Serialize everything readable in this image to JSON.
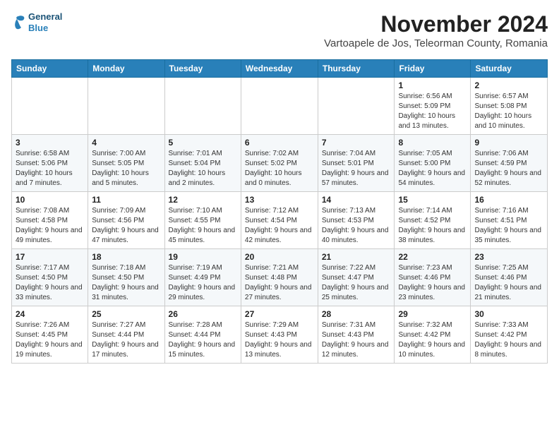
{
  "logo": {
    "line1": "General",
    "line2": "Blue"
  },
  "title": "November 2024",
  "subtitle": "Vartoapele de Jos, Teleorman County, Romania",
  "weekdays": [
    "Sunday",
    "Monday",
    "Tuesday",
    "Wednesday",
    "Thursday",
    "Friday",
    "Saturday"
  ],
  "weeks": [
    [
      {
        "day": "",
        "info": ""
      },
      {
        "day": "",
        "info": ""
      },
      {
        "day": "",
        "info": ""
      },
      {
        "day": "",
        "info": ""
      },
      {
        "day": "",
        "info": ""
      },
      {
        "day": "1",
        "info": "Sunrise: 6:56 AM\nSunset: 5:09 PM\nDaylight: 10 hours and 13 minutes."
      },
      {
        "day": "2",
        "info": "Sunrise: 6:57 AM\nSunset: 5:08 PM\nDaylight: 10 hours and 10 minutes."
      }
    ],
    [
      {
        "day": "3",
        "info": "Sunrise: 6:58 AM\nSunset: 5:06 PM\nDaylight: 10 hours and 7 minutes."
      },
      {
        "day": "4",
        "info": "Sunrise: 7:00 AM\nSunset: 5:05 PM\nDaylight: 10 hours and 5 minutes."
      },
      {
        "day": "5",
        "info": "Sunrise: 7:01 AM\nSunset: 5:04 PM\nDaylight: 10 hours and 2 minutes."
      },
      {
        "day": "6",
        "info": "Sunrise: 7:02 AM\nSunset: 5:02 PM\nDaylight: 10 hours and 0 minutes."
      },
      {
        "day": "7",
        "info": "Sunrise: 7:04 AM\nSunset: 5:01 PM\nDaylight: 9 hours and 57 minutes."
      },
      {
        "day": "8",
        "info": "Sunrise: 7:05 AM\nSunset: 5:00 PM\nDaylight: 9 hours and 54 minutes."
      },
      {
        "day": "9",
        "info": "Sunrise: 7:06 AM\nSunset: 4:59 PM\nDaylight: 9 hours and 52 minutes."
      }
    ],
    [
      {
        "day": "10",
        "info": "Sunrise: 7:08 AM\nSunset: 4:58 PM\nDaylight: 9 hours and 49 minutes."
      },
      {
        "day": "11",
        "info": "Sunrise: 7:09 AM\nSunset: 4:56 PM\nDaylight: 9 hours and 47 minutes."
      },
      {
        "day": "12",
        "info": "Sunrise: 7:10 AM\nSunset: 4:55 PM\nDaylight: 9 hours and 45 minutes."
      },
      {
        "day": "13",
        "info": "Sunrise: 7:12 AM\nSunset: 4:54 PM\nDaylight: 9 hours and 42 minutes."
      },
      {
        "day": "14",
        "info": "Sunrise: 7:13 AM\nSunset: 4:53 PM\nDaylight: 9 hours and 40 minutes."
      },
      {
        "day": "15",
        "info": "Sunrise: 7:14 AM\nSunset: 4:52 PM\nDaylight: 9 hours and 38 minutes."
      },
      {
        "day": "16",
        "info": "Sunrise: 7:16 AM\nSunset: 4:51 PM\nDaylight: 9 hours and 35 minutes."
      }
    ],
    [
      {
        "day": "17",
        "info": "Sunrise: 7:17 AM\nSunset: 4:50 PM\nDaylight: 9 hours and 33 minutes."
      },
      {
        "day": "18",
        "info": "Sunrise: 7:18 AM\nSunset: 4:50 PM\nDaylight: 9 hours and 31 minutes."
      },
      {
        "day": "19",
        "info": "Sunrise: 7:19 AM\nSunset: 4:49 PM\nDaylight: 9 hours and 29 minutes."
      },
      {
        "day": "20",
        "info": "Sunrise: 7:21 AM\nSunset: 4:48 PM\nDaylight: 9 hours and 27 minutes."
      },
      {
        "day": "21",
        "info": "Sunrise: 7:22 AM\nSunset: 4:47 PM\nDaylight: 9 hours and 25 minutes."
      },
      {
        "day": "22",
        "info": "Sunrise: 7:23 AM\nSunset: 4:46 PM\nDaylight: 9 hours and 23 minutes."
      },
      {
        "day": "23",
        "info": "Sunrise: 7:25 AM\nSunset: 4:46 PM\nDaylight: 9 hours and 21 minutes."
      }
    ],
    [
      {
        "day": "24",
        "info": "Sunrise: 7:26 AM\nSunset: 4:45 PM\nDaylight: 9 hours and 19 minutes."
      },
      {
        "day": "25",
        "info": "Sunrise: 7:27 AM\nSunset: 4:44 PM\nDaylight: 9 hours and 17 minutes."
      },
      {
        "day": "26",
        "info": "Sunrise: 7:28 AM\nSunset: 4:44 PM\nDaylight: 9 hours and 15 minutes."
      },
      {
        "day": "27",
        "info": "Sunrise: 7:29 AM\nSunset: 4:43 PM\nDaylight: 9 hours and 13 minutes."
      },
      {
        "day": "28",
        "info": "Sunrise: 7:31 AM\nSunset: 4:43 PM\nDaylight: 9 hours and 12 minutes."
      },
      {
        "day": "29",
        "info": "Sunrise: 7:32 AM\nSunset: 4:42 PM\nDaylight: 9 hours and 10 minutes."
      },
      {
        "day": "30",
        "info": "Sunrise: 7:33 AM\nSunset: 4:42 PM\nDaylight: 9 hours and 8 minutes."
      }
    ]
  ]
}
